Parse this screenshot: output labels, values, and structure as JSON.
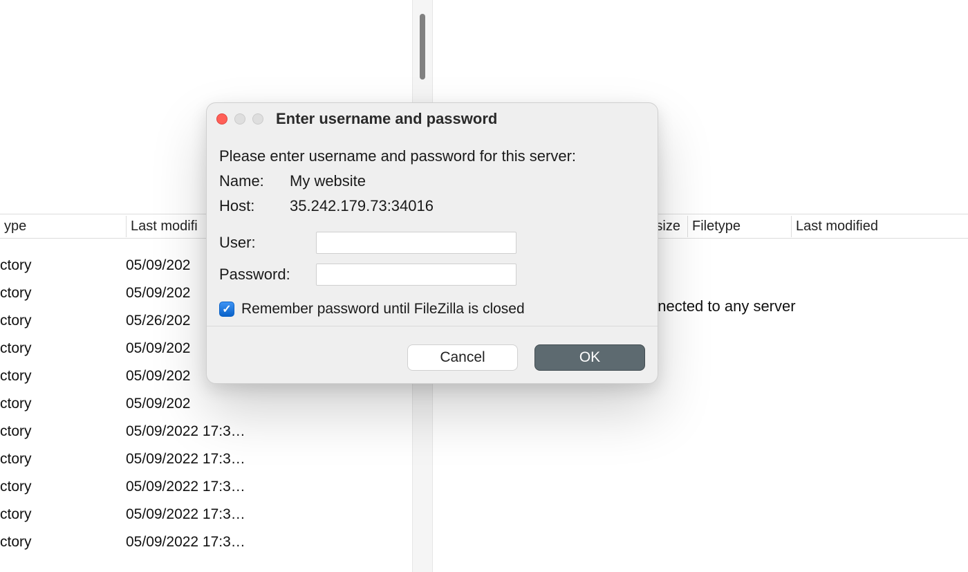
{
  "dialog": {
    "title": "Enter username and password",
    "prompt": "Please enter username and password for this server:",
    "name_label": "Name:",
    "name_value": "My website",
    "host_label": "Host:",
    "host_value": "35.242.179.73:34016",
    "user_label": "User:",
    "user_value": "",
    "password_label": "Password:",
    "password_value": "",
    "remember_checked": true,
    "remember_label": "Remember password until FileZilla is closed",
    "cancel_label": "Cancel",
    "ok_label": "OK"
  },
  "left": {
    "headers": [
      "ype",
      "Last modifi"
    ],
    "rows": [
      {
        "type": "ctory",
        "modified": "05/09/202"
      },
      {
        "type": "ctory",
        "modified": "05/09/202"
      },
      {
        "type": "ctory",
        "modified": "05/26/202"
      },
      {
        "type": "ctory",
        "modified": "05/09/202"
      },
      {
        "type": "ctory",
        "modified": "05/09/202"
      },
      {
        "type": "ctory",
        "modified": "05/09/202"
      },
      {
        "type": "ctory",
        "modified": "05/09/2022 17:3…"
      },
      {
        "type": "ctory",
        "modified": "05/09/2022 17:3…"
      },
      {
        "type": "ctory",
        "modified": "05/09/2022 17:3…"
      },
      {
        "type": "ctory",
        "modified": "05/09/2022 17:3…"
      },
      {
        "type": "ctory",
        "modified": "05/09/2022 17:3…"
      }
    ]
  },
  "right": {
    "headers": [
      "Filesize",
      "Filetype",
      "Last modified"
    ],
    "message": "Not connected to any server"
  }
}
